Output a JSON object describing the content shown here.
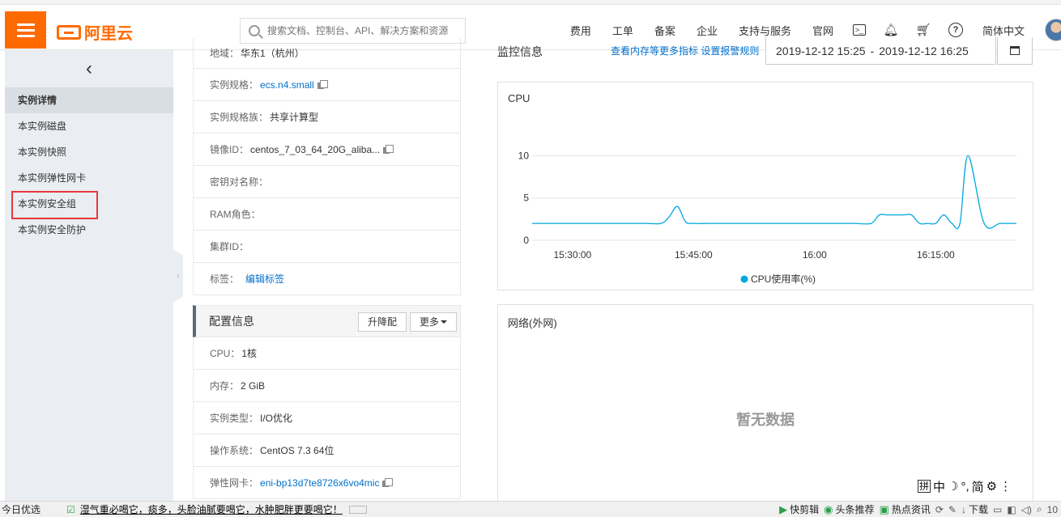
{
  "topbar": {
    "logo_text": "阿里云",
    "search_placeholder": "搜索文档、控制台、API、解决方案和资源",
    "nav_items": [
      "费用",
      "工单",
      "备案",
      "企业",
      "支持与服务",
      "官网"
    ],
    "language": "简体中文",
    "icons": [
      "terminal-icon",
      "bell-icon",
      "cart-icon",
      "help-icon"
    ]
  },
  "sidebar": {
    "items": [
      {
        "label": "实例详情",
        "active": true
      },
      {
        "label": "本实例磁盘"
      },
      {
        "label": "本实例快照"
      },
      {
        "label": "本实例弹性网卡"
      },
      {
        "label": "本实例安全组",
        "highlighted": true
      },
      {
        "label": "本实例安全防护"
      }
    ]
  },
  "basic_info": {
    "rows": [
      {
        "key": "地域：",
        "value": "华东1（杭州）"
      },
      {
        "key": "实例规格：",
        "value": "ecs.n4.small",
        "link": true,
        "copy": true
      },
      {
        "key": "实例规格族：",
        "value": "共享计算型"
      },
      {
        "key": "镜像ID：",
        "value": "centos_7_03_64_20G_aliba...",
        "copy": true
      },
      {
        "key": "密钥对名称：",
        "value": ""
      },
      {
        "key": "RAM角色：",
        "value": ""
      },
      {
        "key": "集群ID：",
        "value": ""
      },
      {
        "key": "标签：",
        "value": "编辑标签",
        "link": true
      }
    ]
  },
  "config": {
    "title": "配置信息",
    "btn_upgrade": "升降配",
    "btn_more": "更多",
    "rows": [
      {
        "key": "CPU：",
        "value": "1核"
      },
      {
        "key": "内存：",
        "value": "2 GiB"
      },
      {
        "key": "实例类型：",
        "value": "I/O优化"
      },
      {
        "key": "操作系统：",
        "value": "CentOS 7.3 64位"
      },
      {
        "key": "弹性网卡：",
        "value": "eni-bp13d7te8726x6vo4mic",
        "link": true,
        "copy": true
      }
    ]
  },
  "monitor": {
    "title": "监控信息",
    "links": "查看内存等更多指标 设置报警规则",
    "date_start": "2019-12-12 15:25",
    "date_sep": "-",
    "date_end": "2019-12-12 16:25",
    "network_title": "网络(外网)",
    "no_data": "暂无数据"
  },
  "chart_data": {
    "type": "line",
    "title": "CPU",
    "x": [
      "15:25",
      "15:27",
      "15:29",
      "15:31",
      "15:33",
      "15:35",
      "15:37",
      "15:39",
      "15:41",
      "15:42",
      "15:43",
      "15:44",
      "15:45",
      "15:47",
      "15:49",
      "15:51",
      "15:53",
      "15:55",
      "15:57",
      "15:59",
      "16:01",
      "16:03",
      "16:05",
      "16:07",
      "16:08",
      "16:09",
      "16:11",
      "16:12",
      "16:13",
      "16:14",
      "16:15",
      "16:16",
      "16:17",
      "16:18",
      "16:19",
      "16:21",
      "16:23",
      "16:25"
    ],
    "series": [
      {
        "name": "CPU使用率(%)",
        "color": "#00a8e1",
        "values": [
          2,
          2,
          2,
          2,
          2,
          2,
          2,
          2,
          2,
          2.8,
          4,
          2.2,
          2,
          2,
          2,
          2,
          2,
          2,
          2,
          2,
          2,
          2,
          2,
          2,
          3,
          3,
          3,
          3,
          2,
          2,
          2,
          3,
          2,
          2,
          10,
          2,
          2,
          2
        ]
      }
    ],
    "xticks": [
      "15:30:00",
      "15:45:00",
      "16:00",
      "16:15:00"
    ],
    "yticks": [
      0,
      5,
      10
    ],
    "ylim": [
      0,
      11
    ]
  },
  "ime": {
    "items": [
      "拼",
      "中",
      "☽",
      "°,",
      "简",
      "⚙",
      "⋮"
    ]
  },
  "statusbar": {
    "left": "今日优选",
    "news": "湿气重必喝它，痰多，头脸油腻要喝它，水肿肥胖更要喝它！",
    "right_items": [
      "快剪辑",
      "头条推荐",
      "热点资讯",
      "下载"
    ],
    "zoom": "10"
  }
}
